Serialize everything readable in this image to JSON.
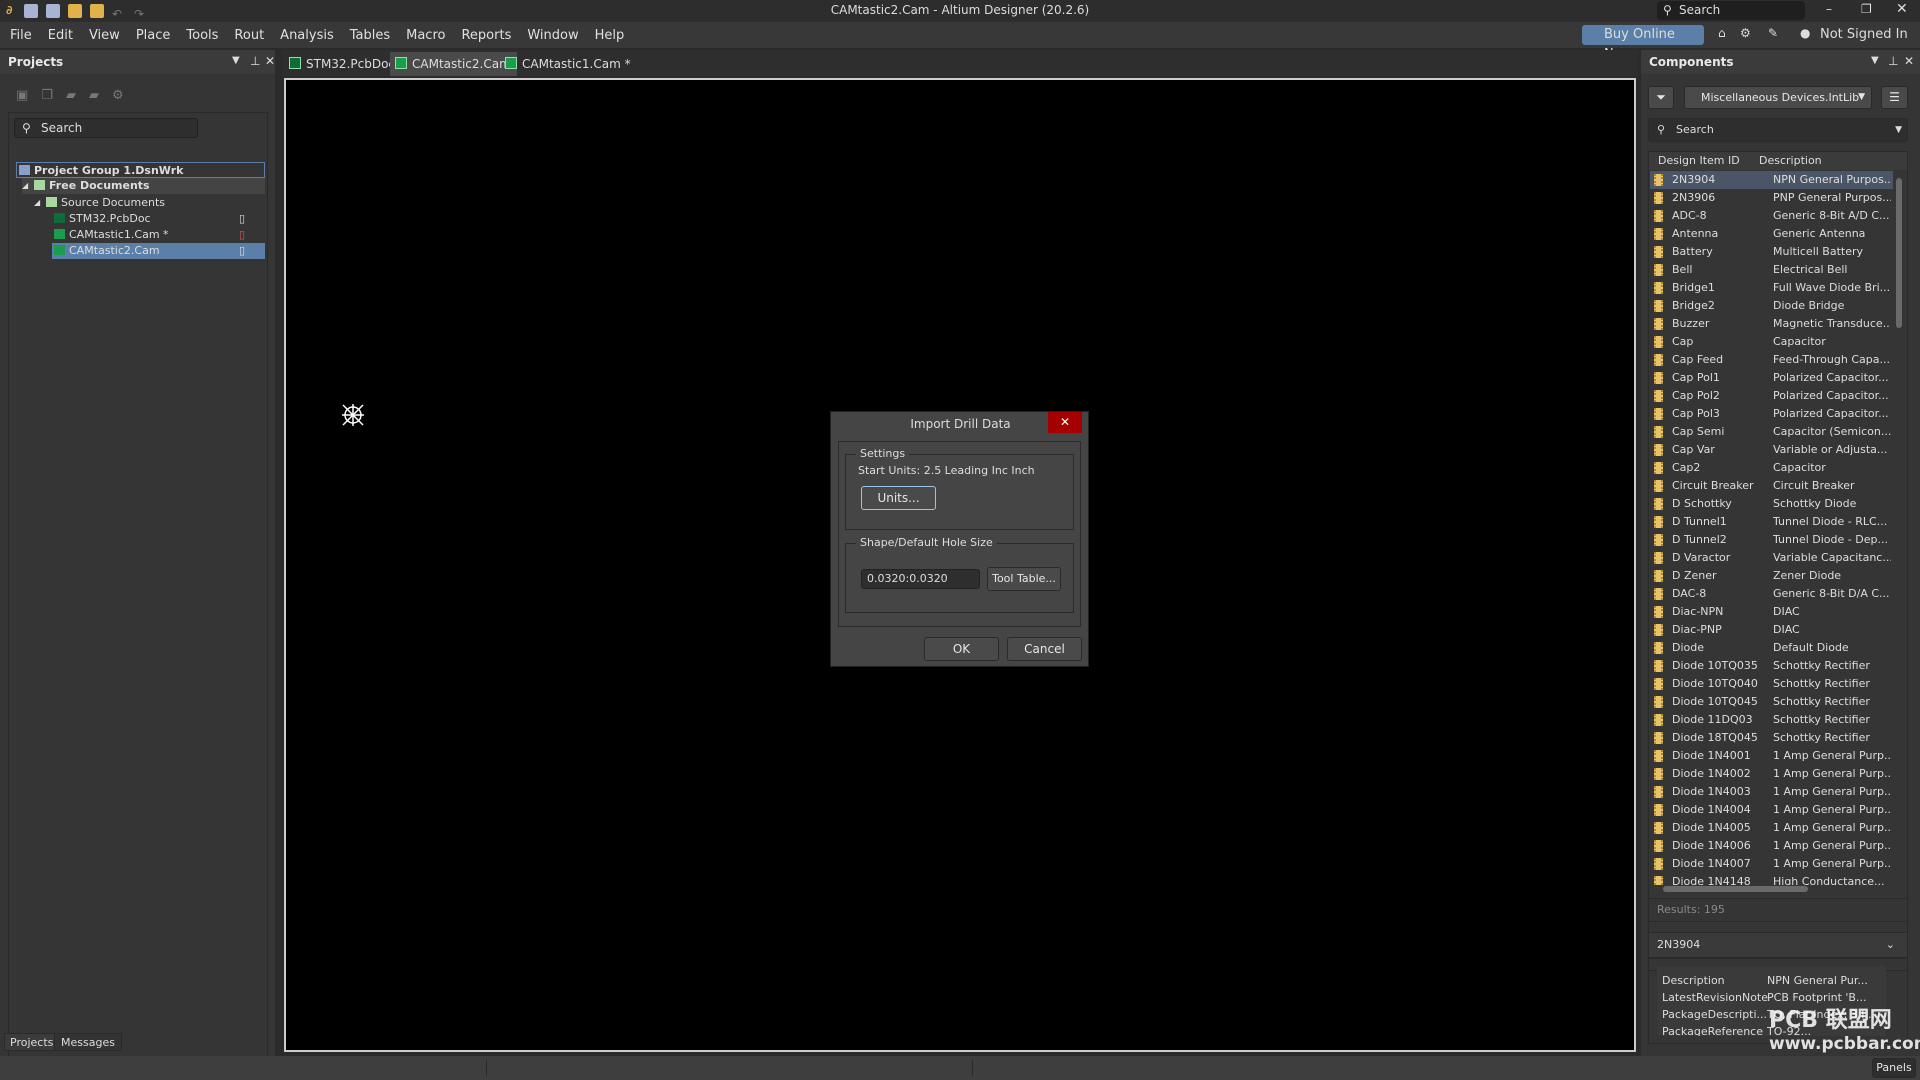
{
  "window": {
    "title": "CAMtastic2.Cam - Altium Designer (20.2.6)",
    "search_placeholder": "Search"
  },
  "menu": [
    "File",
    "Edit",
    "View",
    "Place",
    "Tools",
    "Rout",
    "Analysis",
    "Tables",
    "Macro",
    "Reports",
    "Window",
    "Help"
  ],
  "header_right": {
    "buy": "Buy Online Now",
    "user": "Not Signed In"
  },
  "projects": {
    "title": "Projects",
    "search_placeholder": "Search",
    "tree": [
      "Project Group 1.DsnWrk",
      "Free Documents",
      "Source Documents",
      "STM32.PcbDoc",
      "CAMtastic1.Cam *",
      "CAMtastic2.Cam"
    ],
    "bottom_tabs": [
      "Projects",
      "Messages"
    ]
  },
  "doc_tabs": [
    "STM32.PcbDoc",
    "CAMtastic2.Cam",
    "CAMtastic1.Cam *"
  ],
  "dialog": {
    "title": "Import Drill Data",
    "settings_label": "Settings",
    "start_units": "Start Units: 2.5 Leading Inc Inch",
    "units_button": "Units...",
    "hole_label": "Shape/Default Hole Size",
    "hole_value": "0.0320:0.0320",
    "tool_table_button": "Tool Table...",
    "ok": "OK",
    "cancel": "Cancel"
  },
  "components": {
    "title": "Components",
    "library": "Miscellaneous Devices.IntLib",
    "search_placeholder": "Search",
    "columns": [
      "Design Item ID",
      "Description"
    ],
    "rows": [
      [
        "2N3904",
        "NPN General Purpos..."
      ],
      [
        "2N3906",
        "PNP General Purpos..."
      ],
      [
        "ADC-8",
        "Generic 8-Bit A/D C..."
      ],
      [
        "Antenna",
        "Generic Antenna"
      ],
      [
        "Battery",
        "Multicell Battery"
      ],
      [
        "Bell",
        "Electrical Bell"
      ],
      [
        "Bridge1",
        "Full Wave Diode Bri..."
      ],
      [
        "Bridge2",
        "Diode Bridge"
      ],
      [
        "Buzzer",
        "Magnetic Transduce..."
      ],
      [
        "Cap",
        "Capacitor"
      ],
      [
        "Cap Feed",
        "Feed-Through Capa..."
      ],
      [
        "Cap Pol1",
        "Polarized Capacitor..."
      ],
      [
        "Cap Pol2",
        "Polarized Capacitor..."
      ],
      [
        "Cap Pol3",
        "Polarized Capacitor..."
      ],
      [
        "Cap Semi",
        "Capacitor (Semicon..."
      ],
      [
        "Cap Var",
        "Variable or Adjusta..."
      ],
      [
        "Cap2",
        "Capacitor"
      ],
      [
        "Circuit Breaker",
        "Circuit Breaker"
      ],
      [
        "D Schottky",
        "Schottky Diode"
      ],
      [
        "D Tunnel1",
        "Tunnel Diode - RLC..."
      ],
      [
        "D Tunnel2",
        "Tunnel Diode - Dep..."
      ],
      [
        "D Varactor",
        "Variable Capacitanc..."
      ],
      [
        "D Zener",
        "Zener Diode"
      ],
      [
        "DAC-8",
        "Generic 8-Bit D/A C..."
      ],
      [
        "Diac-NPN",
        "DIAC"
      ],
      [
        "Diac-PNP",
        "DIAC"
      ],
      [
        "Diode",
        "Default Diode"
      ],
      [
        "Diode 10TQ035",
        "Schottky Rectifier"
      ],
      [
        "Diode 10TQ040",
        "Schottky Rectifier"
      ],
      [
        "Diode 10TQ045",
        "Schottky Rectifier"
      ],
      [
        "Diode 11DQ03",
        "Schottky Rectifier"
      ],
      [
        "Diode 18TQ045",
        "Schottky Rectifier"
      ],
      [
        "Diode 1N4001",
        "1 Amp General Purp..."
      ],
      [
        "Diode 1N4002",
        "1 Amp General Purp..."
      ],
      [
        "Diode 1N4003",
        "1 Amp General Purp..."
      ],
      [
        "Diode 1N4004",
        "1 Amp General Purp..."
      ],
      [
        "Diode 1N4005",
        "1 Amp General Purp..."
      ],
      [
        "Diode 1N4006",
        "1 Amp General Purp..."
      ],
      [
        "Diode 1N4007",
        "1 Amp General Purp..."
      ],
      [
        "Diode 1N4148",
        "High Conductance..."
      ]
    ],
    "results": "Results: 195",
    "selected": "2N3904",
    "props": [
      [
        "Description",
        "NPN General Pur..."
      ],
      [
        "LatestRevisionNote",
        "PCB Footprint 'B..."
      ],
      [
        "PackageDescripti...",
        "TO, Flat Index; 3 I..."
      ],
      [
        "PackageReference",
        "TO-92..."
      ]
    ]
  },
  "watermark": "PCB联盟网 www.pcbbar.com",
  "panels_button": "Panels",
  "colors": {
    "accent": "#5a7fa8",
    "close_red": "#a50000",
    "canvas": "#000000"
  }
}
